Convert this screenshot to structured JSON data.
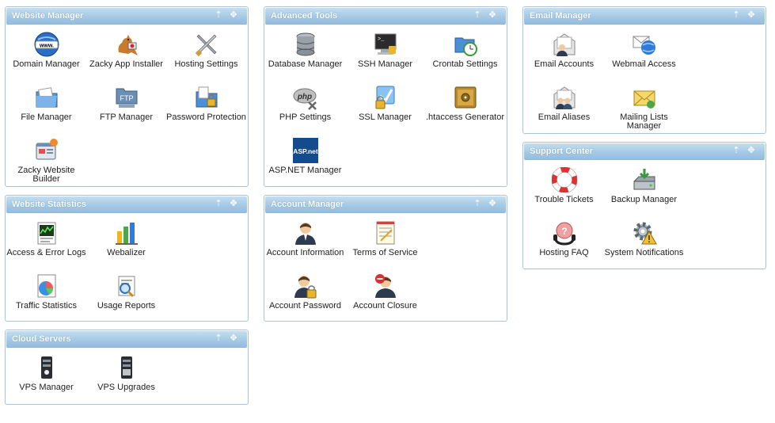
{
  "panels": {
    "website_manager": {
      "title": "Website Manager",
      "items": [
        "Domain Manager",
        "Zacky App Installer",
        "Hosting Settings",
        "File Manager",
        "FTP Manager",
        "Password Protection",
        "Zacky Website Builder"
      ]
    },
    "website_statistics": {
      "title": "Website Statistics",
      "items": [
        "Access & Error Logs",
        "Webalizer",
        "Traffic Statistics",
        "Usage Reports"
      ]
    },
    "cloud_servers": {
      "title": "Cloud Servers",
      "items": [
        "VPS Manager",
        "VPS Upgrades"
      ]
    },
    "advanced_tools": {
      "title": "Advanced Tools",
      "items": [
        "Database Manager",
        "SSH Manager",
        "Crontab Settings",
        "PHP Settings",
        "SSL Manager",
        ".htaccess Generator",
        "ASP.NET Manager"
      ]
    },
    "account_manager": {
      "title": "Account Manager",
      "items": [
        "Account Information",
        "Terms of Service",
        "Account Password",
        "Account Closure"
      ]
    },
    "email_manager": {
      "title": "Email Manager",
      "items": [
        "Email Accounts",
        "Webmail Access",
        "Email Aliases",
        "Mailing Lists Manager"
      ]
    },
    "support_center": {
      "title": "Support Center",
      "items": [
        "Trouble Tickets",
        "Backup Manager",
        "Hosting FAQ",
        "System Notifications"
      ]
    }
  },
  "icon_text": {
    "www": "www.",
    "ftp": "FTP",
    "php": "php",
    "asp": "ASP.net"
  },
  "controls": {
    "pin_symbol": "⇡",
    "move_symbol": "✥"
  }
}
